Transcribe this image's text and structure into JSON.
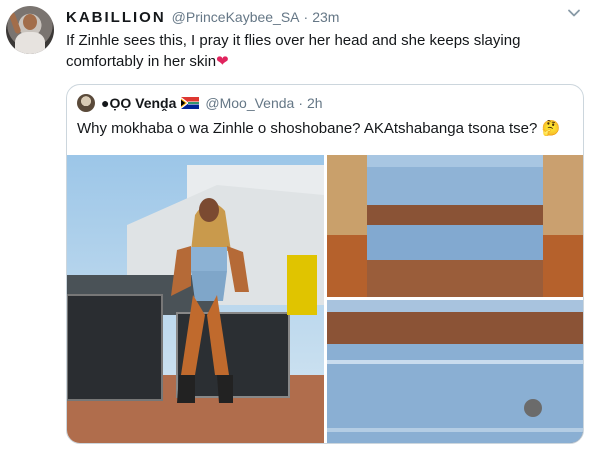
{
  "tweet": {
    "display_name": "KABILLION",
    "handle": "@PrinceKaybee_SA",
    "separator": "·",
    "time": "23m",
    "text": "If Zinhle sees this, I pray it flies over her head and she keeps slaying comfortably in her skin",
    "text_emoji": "❤"
  },
  "quoted_tweet": {
    "display_name": "●ỌỌ Venḓa",
    "handle": "@Moo_Venda",
    "separator": "·",
    "time": "2h",
    "text": "Why mokhaba o wa Zinhle o shoshobane? AKAtshabanga tsona tse?",
    "text_emoji": "🤔"
  },
  "icons": {
    "more": "chevron-down-icon",
    "flag": "south-africa-flag-icon"
  },
  "colors": {
    "primary_text": "#14171a",
    "secondary_text": "#657786",
    "border": "#ccd6dd",
    "heart": "#e0245e"
  }
}
